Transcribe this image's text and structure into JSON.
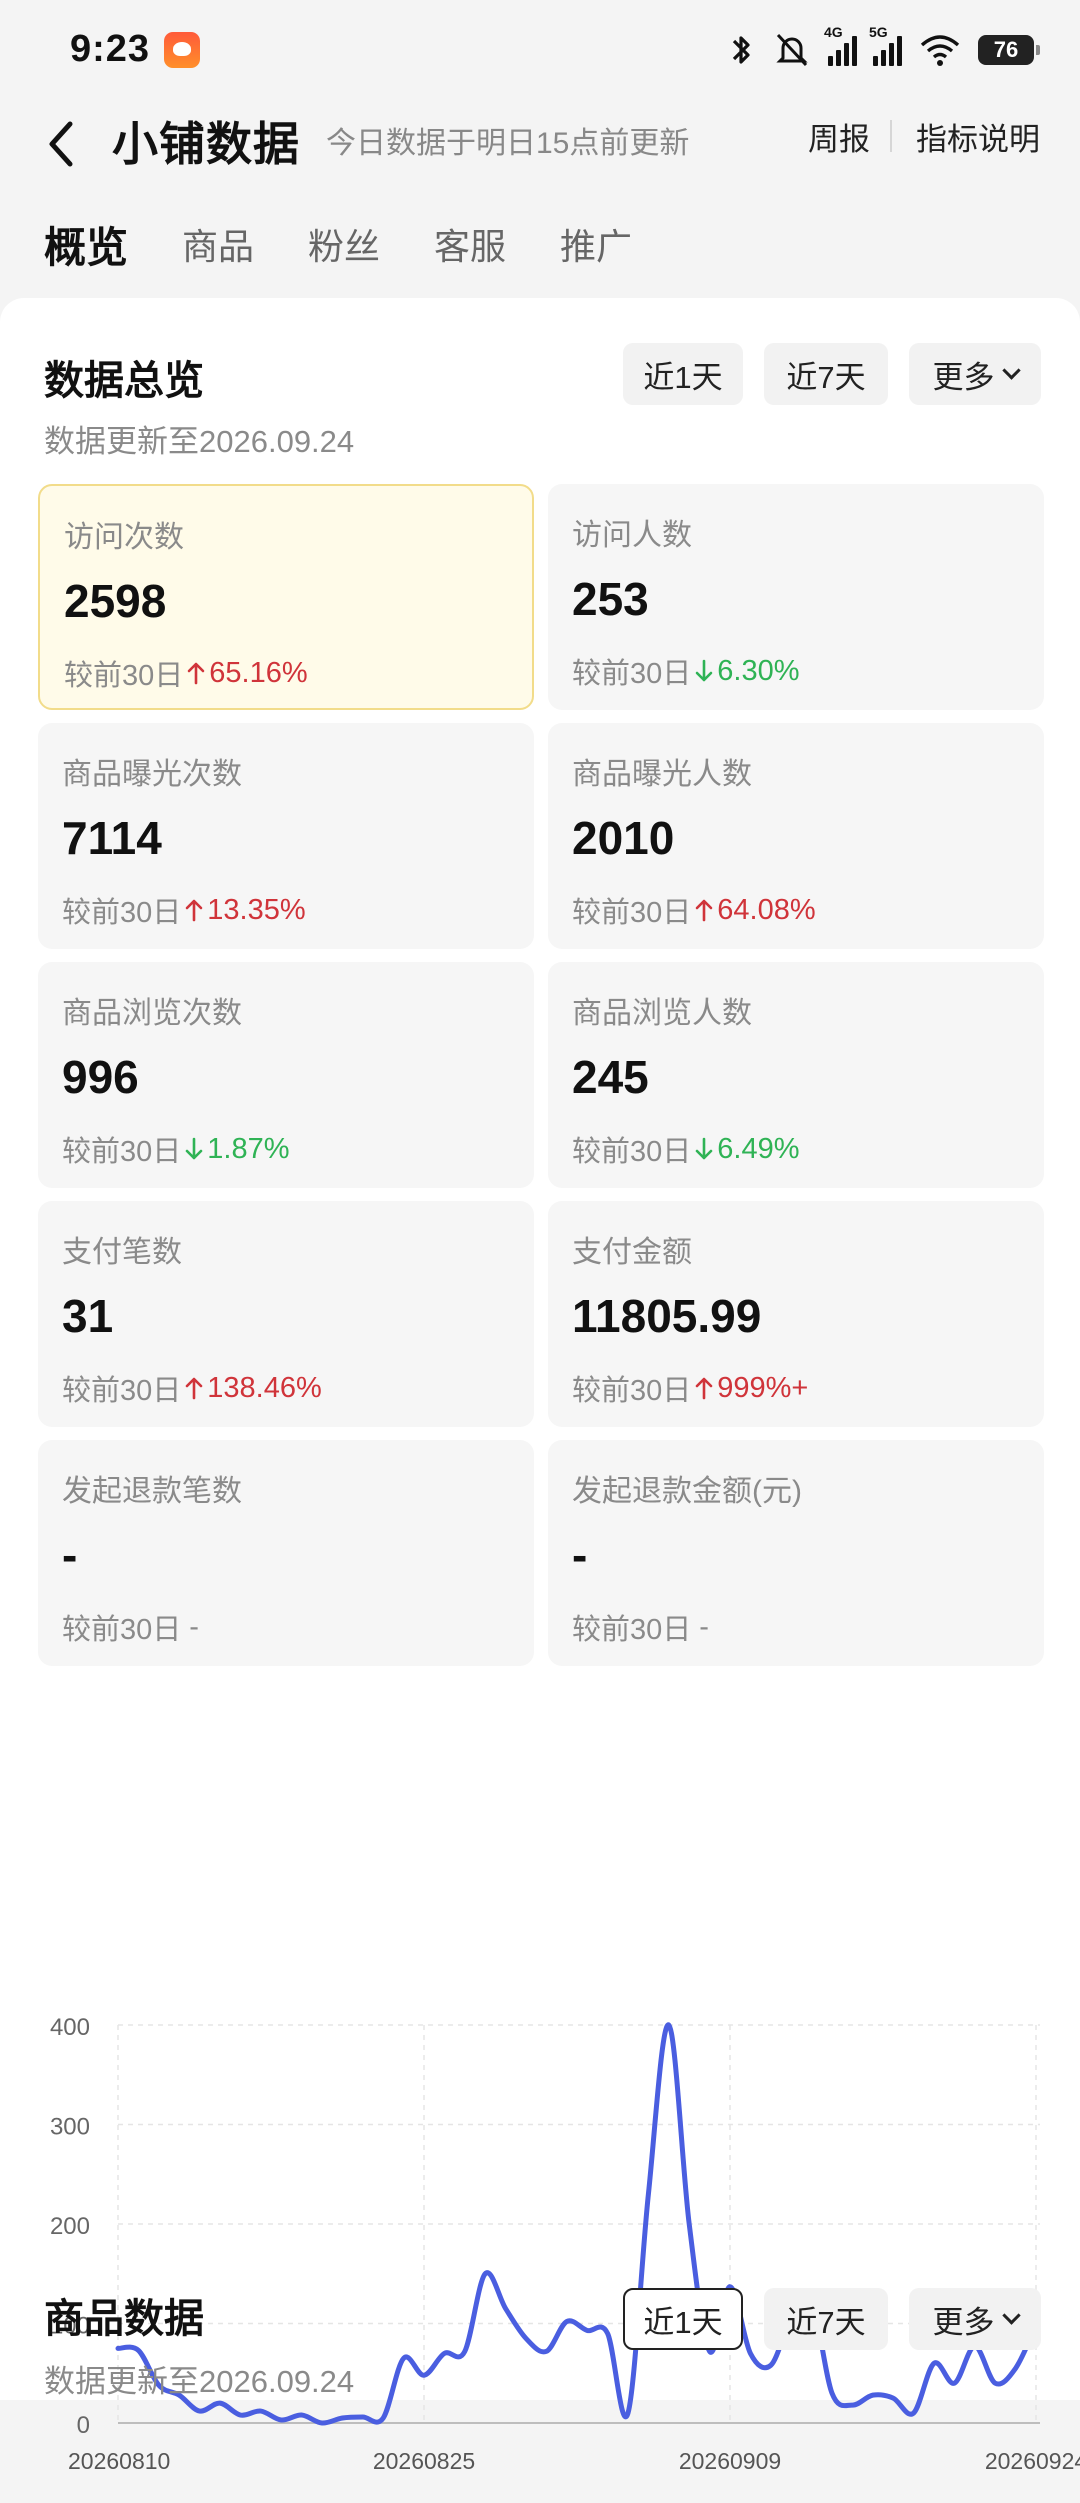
{
  "status": {
    "time": "9:23",
    "battery": "76",
    "net1": "4G",
    "net2": "5G"
  },
  "header": {
    "title": "小铺数据",
    "subtitle": "今日数据于明日15点前更新",
    "weekly": "周报",
    "metric_explain": "指标说明"
  },
  "tabs": [
    "概览",
    "商品",
    "粉丝",
    "客服",
    "推广"
  ],
  "overview": {
    "title": "数据总览",
    "updated": "数据更新至2026.09.24",
    "range_1d": "近1天",
    "range_7d": "近7天",
    "more": "更多",
    "compare_prefix": "较前30日",
    "metrics": [
      {
        "label": "访问次数",
        "value": "2598",
        "dir": "up",
        "change": "65.16%",
        "highlight": true
      },
      {
        "label": "访问人数",
        "value": "253",
        "dir": "down",
        "change": "6.30%"
      },
      {
        "label": "商品曝光次数",
        "value": "7114",
        "dir": "up",
        "change": "13.35%"
      },
      {
        "label": "商品曝光人数",
        "value": "2010",
        "dir": "up",
        "change": "64.08%"
      },
      {
        "label": "商品浏览次数",
        "value": "996",
        "dir": "down",
        "change": "1.87%"
      },
      {
        "label": "商品浏览人数",
        "value": "245",
        "dir": "down",
        "change": "6.49%"
      },
      {
        "label": "支付笔数",
        "value": "31",
        "dir": "up",
        "change": "138.46%"
      },
      {
        "label": "支付金额",
        "value": "11805.99",
        "dir": "up",
        "change": "999%+"
      },
      {
        "label": "发起退款笔数",
        "value": "-",
        "dir": "none",
        "change": "-"
      },
      {
        "label": "发起退款金额(元)",
        "value": "-",
        "dir": "none",
        "change": "-"
      }
    ]
  },
  "chart_data": {
    "type": "line",
    "x_ticks": [
      "20260810",
      "20260825",
      "20260909",
      "20260924"
    ],
    "y_ticks": [
      "0",
      "100",
      "200",
      "300",
      "400"
    ],
    "ylim": [
      0,
      400
    ],
    "color": "#4a5ee0",
    "series": [
      {
        "values": [
          75,
          73,
          38,
          28,
          12,
          20,
          8,
          12,
          3,
          8,
          0,
          5,
          6,
          5,
          65,
          48,
          70,
          72,
          150,
          115,
          85,
          72,
          102,
          93,
          90,
          10,
          230,
          400,
          200,
          72,
          137,
          70,
          58,
          105,
          122,
          30,
          18,
          28,
          25,
          10,
          60,
          40,
          77,
          40,
          55,
          98
        ]
      }
    ]
  },
  "product": {
    "title": "商品数据",
    "updated": "数据更新至2026.09.24",
    "range_1d": "近1天",
    "range_7d": "近7天",
    "more": "更多"
  }
}
